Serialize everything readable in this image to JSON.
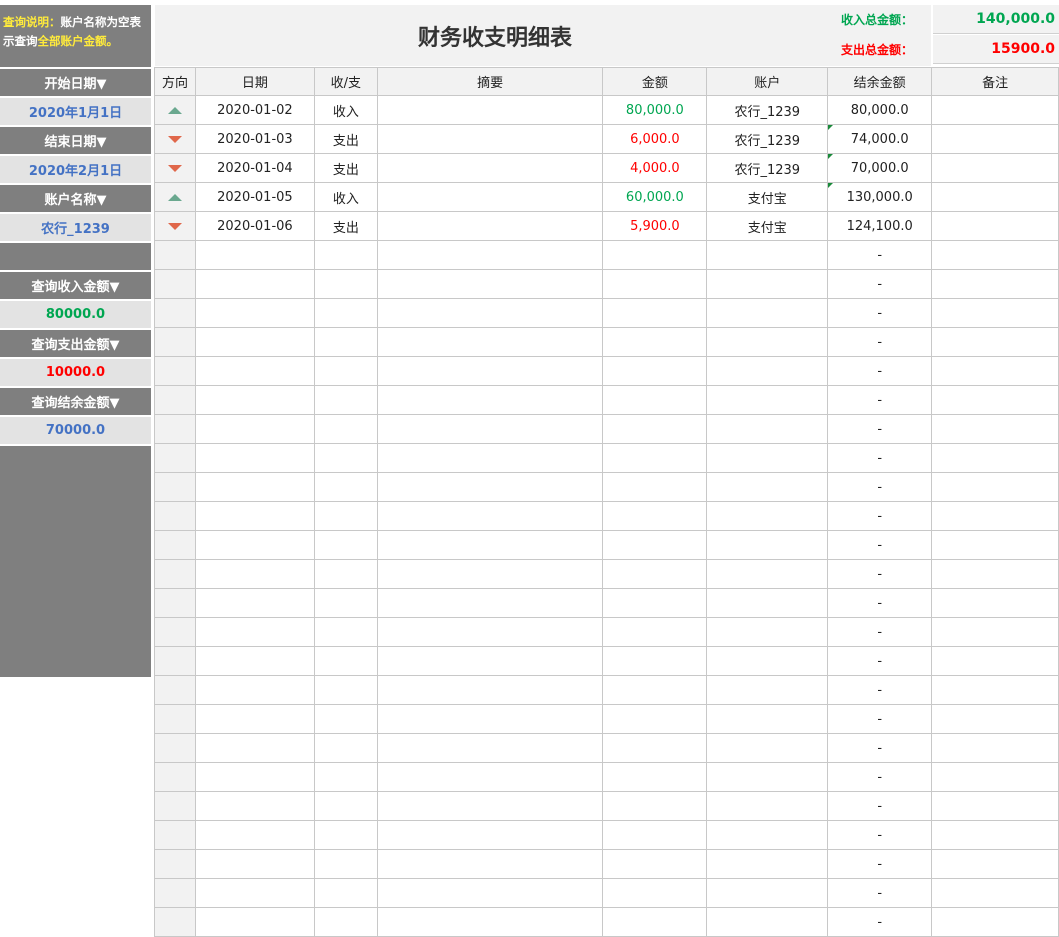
{
  "title": "财务收支明细表",
  "note": {
    "label": "查询说明：",
    "text1": "账户名称为空表示查询",
    "highlight": "全部账户金额",
    "end": "。"
  },
  "left_panel": {
    "start_date_label": "开始日期▼",
    "start_date": "2020年1月1日",
    "end_date_label": "结束日期▼",
    "end_date": "2020年2月1日",
    "account_label": "账户名称▼",
    "account": "农行_1239",
    "income_label": "查询收入金额▼",
    "income": "80000.0",
    "expense_label": "查询支出金额▼",
    "expense": "10000.0",
    "balance_label": "查询结余金额▼",
    "balance": "70000.0"
  },
  "totals": {
    "income_label": "收入总金额：",
    "income": "140,000.0",
    "expense_label": "支出总金额：",
    "expense": "15900.0"
  },
  "columns": [
    "方向",
    "日期",
    "收/支",
    "摘要",
    "金额",
    "账户",
    "结余金额",
    "备注"
  ],
  "rows": [
    {
      "dir": "up",
      "date": "2020-01-02",
      "type": "收入",
      "summary": "",
      "amount": "80,000.0",
      "account": "农行_1239",
      "balance": "80,000.0",
      "note": "",
      "corner": false
    },
    {
      "dir": "down",
      "date": "2020-01-03",
      "type": "支出",
      "summary": "",
      "amount": "6,000.0",
      "account": "农行_1239",
      "balance": "74,000.0",
      "note": "",
      "corner": true
    },
    {
      "dir": "down",
      "date": "2020-01-04",
      "type": "支出",
      "summary": "",
      "amount": "4,000.0",
      "account": "农行_1239",
      "balance": "70,000.0",
      "note": "",
      "corner": true
    },
    {
      "dir": "up",
      "date": "2020-01-05",
      "type": "收入",
      "summary": "",
      "amount": "60,000.0",
      "account": "支付宝",
      "balance": "130,000.0",
      "note": "",
      "corner": true
    },
    {
      "dir": "down",
      "date": "2020-01-06",
      "type": "支出",
      "summary": "",
      "amount": "5,900.0",
      "account": "支付宝",
      "balance": "124,100.0",
      "note": "",
      "corner": false
    }
  ],
  "empty_balance": "-",
  "empty_row_count": 24,
  "colors": {
    "income": "#00a651",
    "expense": "#ff0000",
    "accent_blue": "#4472c4",
    "panel_gray": "#7f7f7f",
    "up_arrow": "#6aa88f",
    "down_arrow": "#e0674a"
  },
  "icons": {
    "up": "triangle-up-icon",
    "down": "triangle-down-icon"
  }
}
